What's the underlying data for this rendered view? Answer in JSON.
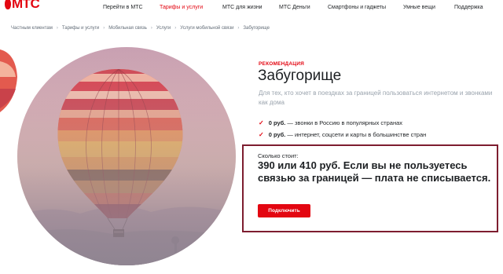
{
  "brand": {
    "logo_text": "МТС",
    "accent": "#e30611"
  },
  "topnav": {
    "items": [
      {
        "label": "Перейти в МТС"
      },
      {
        "label": "Тарифы и услуги",
        "active": true
      },
      {
        "label": "МТС для жизни"
      },
      {
        "label": "МТС Деньги"
      },
      {
        "label": "Смартфоны и гаджеты"
      },
      {
        "label": "Умные вещи"
      },
      {
        "label": "Поддержка"
      }
    ]
  },
  "breadcrumbs": [
    "Частным клиентам",
    "Тарифы и услуги",
    "Мобильная связь",
    "Услуги",
    "Услуги мобильной связи",
    "Забугорище"
  ],
  "offer": {
    "recommendation_label": "РЕКОМЕНДАЦИЯ",
    "title": "Забугорище",
    "subtitle": "Для тех, кто хочет в поездках за границей пользоваться интернетом и звонками как дома",
    "features": [
      {
        "price": "0 руб.",
        "text": " — звонки в Россию в популярных странах"
      },
      {
        "price": "0 руб.",
        "text": " — интернет, соцсети и карты в большинстве стран"
      }
    ],
    "cost_label": "Сколько стоит:",
    "cost_text": "390 или 410 руб. Если вы не пользуетесь связью за границей — плата не списывается.",
    "connect_button": "Подключить"
  },
  "colors": {
    "highlight_border": "#7d1d2f",
    "muted_text": "#9aa3ad"
  }
}
